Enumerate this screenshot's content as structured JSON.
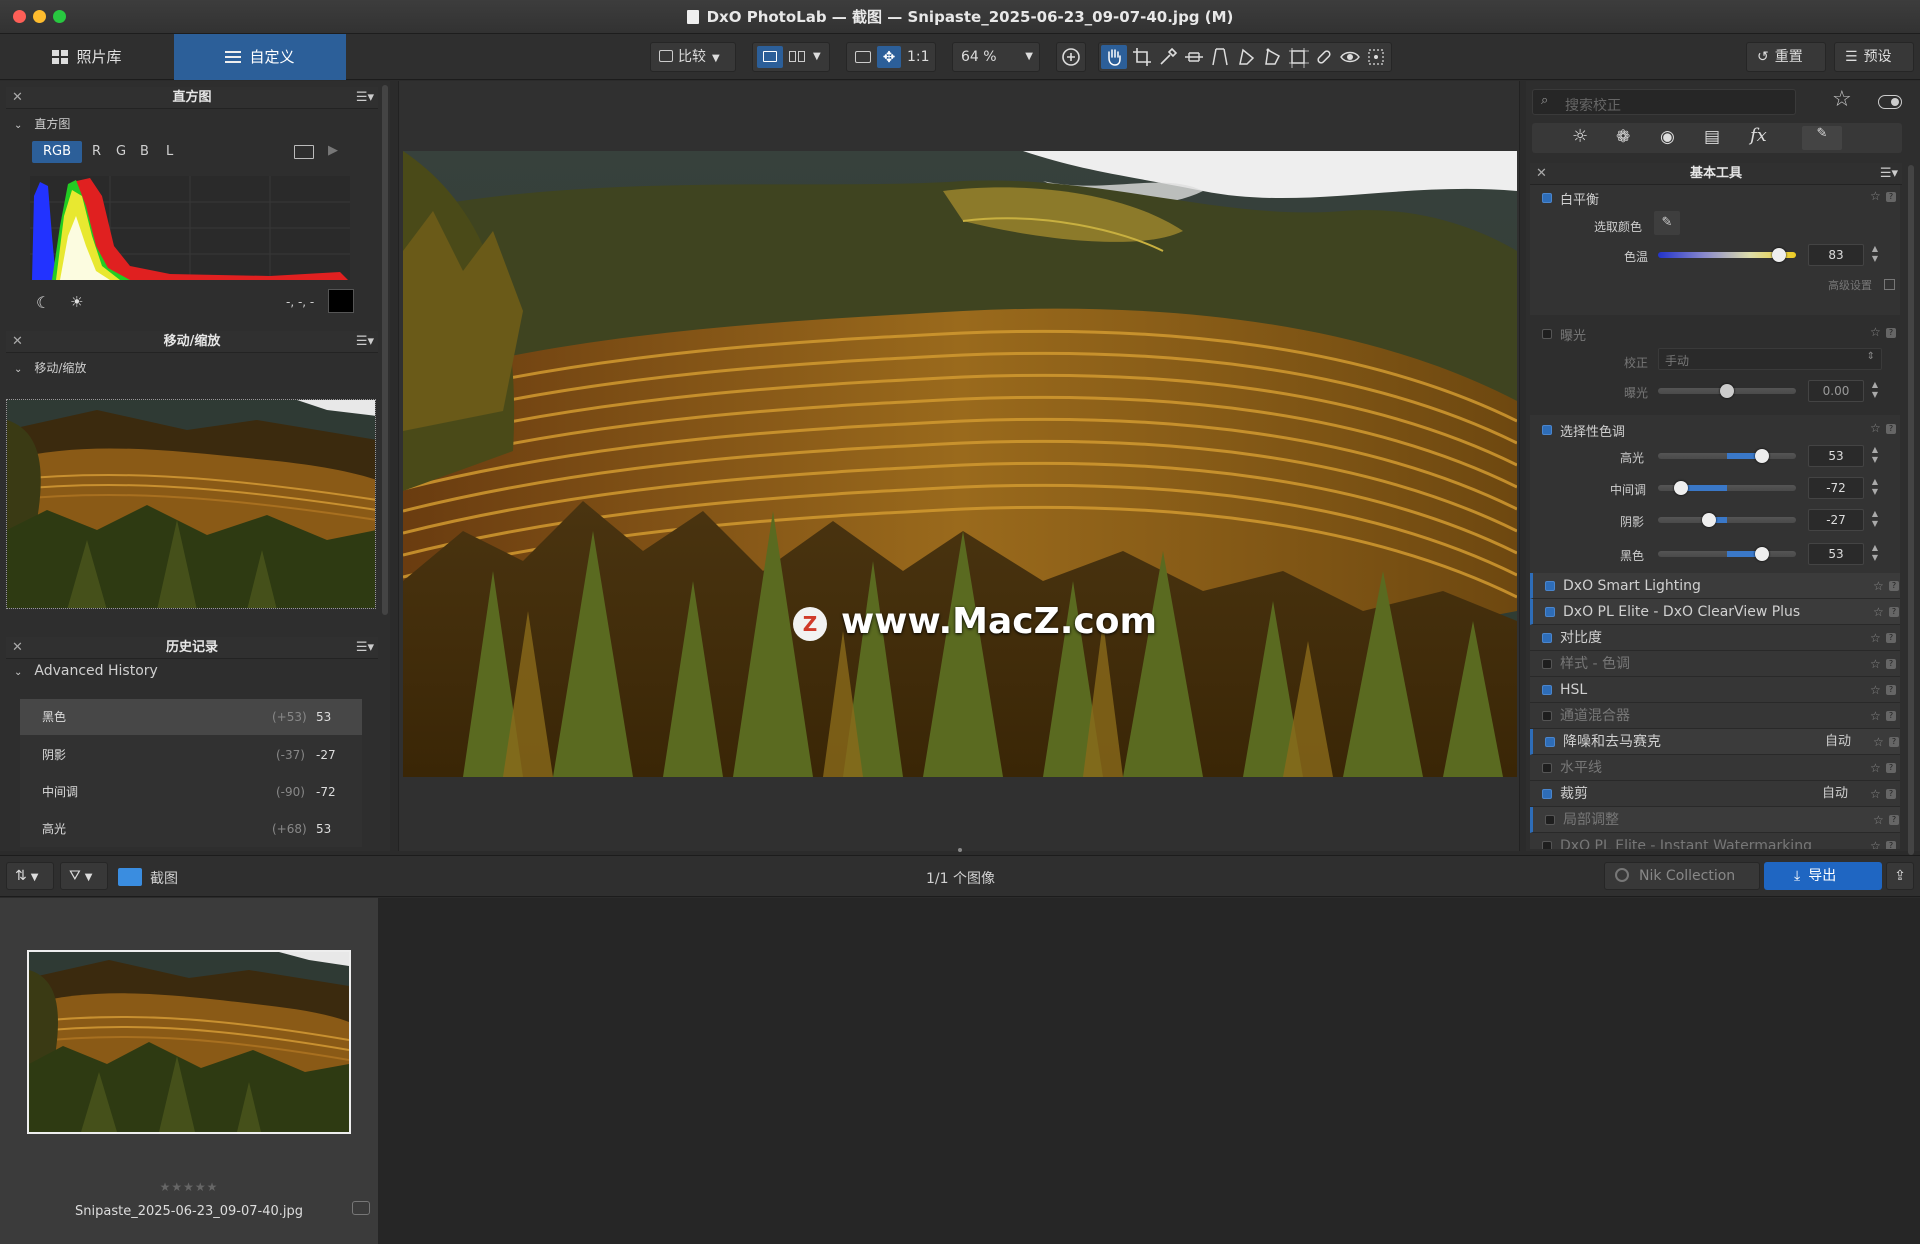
{
  "window": {
    "title": "DxO PhotoLab — 截图 — Snipaste_2025-06-23_09-07-40.jpg (M)"
  },
  "modes": {
    "library": "照片库",
    "customize": "自定义"
  },
  "toolbar": {
    "compare": "比较",
    "one_to_one": "1:1",
    "zoom": "64 %",
    "reset": "重置",
    "presets": "预设"
  },
  "histogram": {
    "title": "直方图",
    "section": "直方图",
    "channels": [
      "RGB",
      "R",
      "G",
      "B",
      "L"
    ],
    "readout": "-, -, -"
  },
  "navigator": {
    "title": "移动/缩放",
    "section": "移动/缩放"
  },
  "history": {
    "title": "历史记录",
    "section": "Advanced History",
    "items": [
      {
        "name": "黑色",
        "delta": "(+53)",
        "value": "53"
      },
      {
        "name": "阴影",
        "delta": "(-37)",
        "value": "-27"
      },
      {
        "name": "中间调",
        "delta": "(-90)",
        "value": "-72"
      },
      {
        "name": "高光",
        "delta": "(+68)",
        "value": "53"
      }
    ]
  },
  "viewer": {
    "watermark": "www.MacZ.com",
    "watermark_badge": "Z"
  },
  "right_panel": {
    "search_placeholder": "搜索校正",
    "palette_title": "基本工具",
    "white_balance": {
      "label": "白平衡",
      "pick_label": "选取颜色",
      "temp_label": "色温",
      "temp_value": "83",
      "temp_fraction": 0.88,
      "advanced": "高级设置"
    },
    "exposure": {
      "label": "曝光",
      "correction_label": "校正",
      "correction_value": "手动",
      "exposure_label": "曝光",
      "exposure_value": "0.00",
      "exposure_fraction": 0.5
    },
    "selective_tone": {
      "label": "选择性色调",
      "rows": [
        {
          "label": "高光",
          "value": "53",
          "fraction": 0.75
        },
        {
          "label": "中间调",
          "value": "-72",
          "fraction": 0.17
        },
        {
          "label": "阴影",
          "value": "-27",
          "fraction": 0.37
        },
        {
          "label": "黑色",
          "value": "53",
          "fraction": 0.75
        }
      ]
    },
    "tools": [
      {
        "label": "DxO Smart Lighting",
        "on": true,
        "extra": ""
      },
      {
        "label": "DxO PL Elite - DxO ClearView Plus",
        "on": true,
        "extra": ""
      },
      {
        "label": "对比度",
        "on": true,
        "extra": ""
      },
      {
        "label": "样式 - 色调",
        "on": false,
        "extra": ""
      },
      {
        "label": "HSL",
        "on": true,
        "extra": ""
      },
      {
        "label": "通道混合器",
        "on": false,
        "extra": ""
      },
      {
        "label": "降噪和去马赛克",
        "on": true,
        "extra": "自动"
      },
      {
        "label": "水平线",
        "on": false,
        "extra": ""
      },
      {
        "label": "裁剪",
        "on": true,
        "extra": "自动"
      },
      {
        "label": "局部调整",
        "on": false,
        "extra": ""
      },
      {
        "label": "DxO PL Elite - Instant Watermarking",
        "on": false,
        "extra": ""
      }
    ]
  },
  "filmstrip": {
    "folder": "截图",
    "count": "1/1 个图像",
    "nik": "Nik Collection",
    "export": "导出",
    "rating": "★★★★★",
    "filename": "Snipaste_2025-06-23_09-07-40.jpg"
  },
  "colors": {
    "accent": "#2e6db8",
    "active_tab": "#2c5f99",
    "export": "#1f66c2"
  }
}
